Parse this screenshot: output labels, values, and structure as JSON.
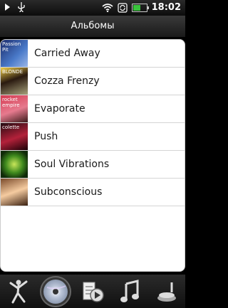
{
  "status_bar": {
    "time": "18:02",
    "icons": [
      "play-icon",
      "usb-icon",
      "wifi-icon",
      "sync-icon",
      "battery-icon"
    ],
    "battery_color": "#39c33c",
    "battery_fraction": 0.6
  },
  "header": {
    "title": "Альбомы"
  },
  "albums": [
    {
      "title": "Carried Away",
      "cover_text": "Passion Pit"
    },
    {
      "title": "Cozza Frenzy",
      "cover_text": "BLONDE"
    },
    {
      "title": "Evaporate",
      "cover_text": "rocket empire"
    },
    {
      "title": "Push",
      "cover_text": "colette"
    },
    {
      "title": "Soul Vibrations",
      "cover_text": ""
    },
    {
      "title": "Subconscious",
      "cover_text": ""
    }
  ],
  "bottom_nav": [
    {
      "name": "artists",
      "icon": "dancer-icon",
      "active": false
    },
    {
      "name": "albums",
      "icon": "cd-icon",
      "active": true
    },
    {
      "name": "playlists",
      "icon": "playlist-icon",
      "active": false
    },
    {
      "name": "songs",
      "icon": "music-note-icon",
      "active": false
    },
    {
      "name": "genres",
      "icon": "turntable-icon",
      "active": false
    }
  ]
}
